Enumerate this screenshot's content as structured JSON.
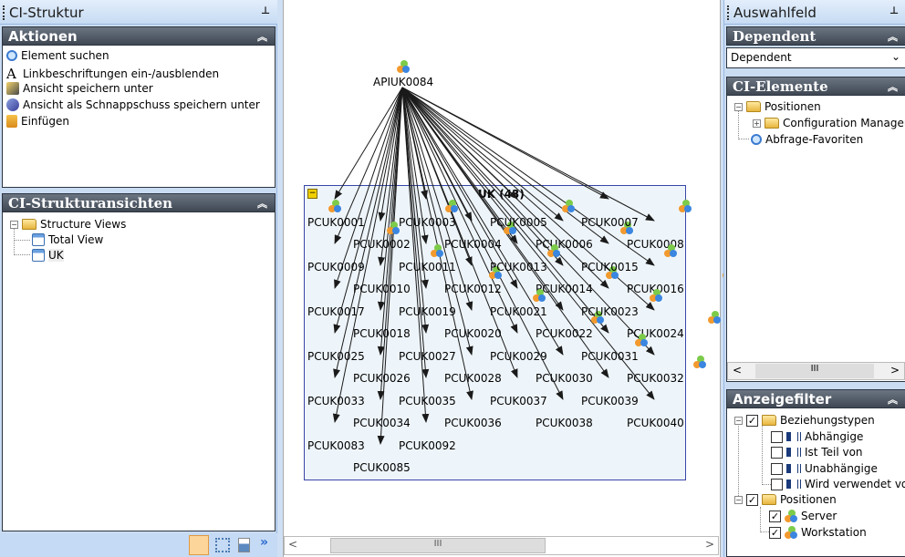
{
  "left_panel": {
    "title": "CI-Struktur",
    "actions": {
      "header": "Aktionen",
      "items": [
        {
          "label": "Element suchen",
          "icon": "search-icon"
        },
        {
          "label": "Linkbeschriftungen ein-/ausblenden",
          "icon": "text-icon"
        },
        {
          "label": "Ansicht speichern unter",
          "icon": "save-view-icon"
        },
        {
          "label": "Ansicht als Schnappschuss speichern unter",
          "icon": "snapshot-icon"
        },
        {
          "label": "Einfügen",
          "icon": "paste-icon"
        }
      ]
    },
    "views": {
      "header": "CI-Strukturansichten",
      "root": "Structure Views",
      "children": [
        "Total View",
        "UK"
      ]
    }
  },
  "canvas": {
    "root": "APIUK0084",
    "group_title": "UK (43)",
    "nodes": [
      "PCUK0001",
      "PCUK0002",
      "PCUK0003",
      "PCUK0004",
      "PCUK0005",
      "PCUK0006",
      "PCUK0007",
      "PCUK0008",
      "PCUK0009",
      "PCUK0010",
      "PCUK0011",
      "PCUK0012",
      "PCUK0013",
      "PCUK0014",
      "PCUK0015",
      "PCUK0016",
      "PCUK0017",
      "PCUK0018",
      "PCUK0019",
      "PCUK0020",
      "PCUK0021",
      "PCUK0022",
      "PCUK0023",
      "PCUK0024",
      "PCUK0025",
      "PCUK0026",
      "PCUK0027",
      "PCUK0028",
      "PCUK0029",
      "PCUK0030",
      "PCUK0031",
      "PCUK0032",
      "PCUK0033",
      "PCUK0034",
      "PCUK0035",
      "PCUK0036",
      "PCUK0037",
      "PCUK0038",
      "PCUK0039",
      "PCUK0040",
      "PCUK0083",
      "PCUK0085",
      "PCUK0092"
    ],
    "scroll_thumb": "III"
  },
  "right_panel": {
    "title": "Auswahlfeld",
    "dependent": {
      "header": "Dependent",
      "selected": "Dependent"
    },
    "ci_elements": {
      "header": "CI-Elemente",
      "root": "Positionen",
      "child": "Configuration Manager",
      "favorites": "Abfrage-Favoriten",
      "scroll_thumb": "III"
    },
    "filter": {
      "header": "Anzeigefilter",
      "rel_root": "Beziehungstypen",
      "rel_items": [
        "Abhängige",
        "Ist Teil von",
        "Unabhängige",
        "Wird verwendet von"
      ],
      "pos_root": "Positionen",
      "pos_items": [
        "Server",
        "Workstation"
      ]
    }
  }
}
